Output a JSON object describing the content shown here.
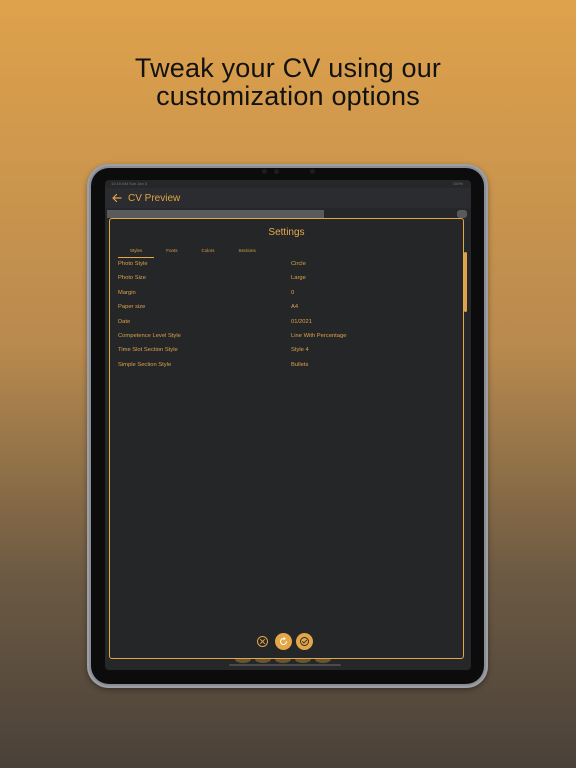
{
  "headline": {
    "line1": "Tweak your CV using our",
    "line2": "customization options"
  },
  "status_bar": {
    "time": "10:15 AM  Sun Jan 3",
    "battery": "100%"
  },
  "navbar": {
    "title": "CV Preview",
    "back_icon": "arrow-left-icon"
  },
  "settings": {
    "title": "Settings",
    "tabs": [
      "Styles",
      "Fonts",
      "Colors",
      "Sections"
    ],
    "active_tab": "Styles",
    "rows": [
      {
        "label": "Photo Style",
        "value": "Circle"
      },
      {
        "label": "Photo Size",
        "value": "Large"
      },
      {
        "label": "Margin",
        "value": "0"
      },
      {
        "label": "Paper size",
        "value": "A4"
      },
      {
        "label": "Date",
        "value": "01/2021"
      },
      {
        "label": "Competence Level Style",
        "value": "Line With Percentage"
      },
      {
        "label": "Time Slot Section Style",
        "value": "Style 4"
      },
      {
        "label": "Simple Section Style",
        "value": "Bullets"
      }
    ],
    "actions": {
      "close_icon": "close-icon",
      "reset_icon": "refresh-icon",
      "confirm_icon": "check-icon"
    }
  },
  "colors": {
    "accent": "#e3a748",
    "panel": "#252628"
  }
}
